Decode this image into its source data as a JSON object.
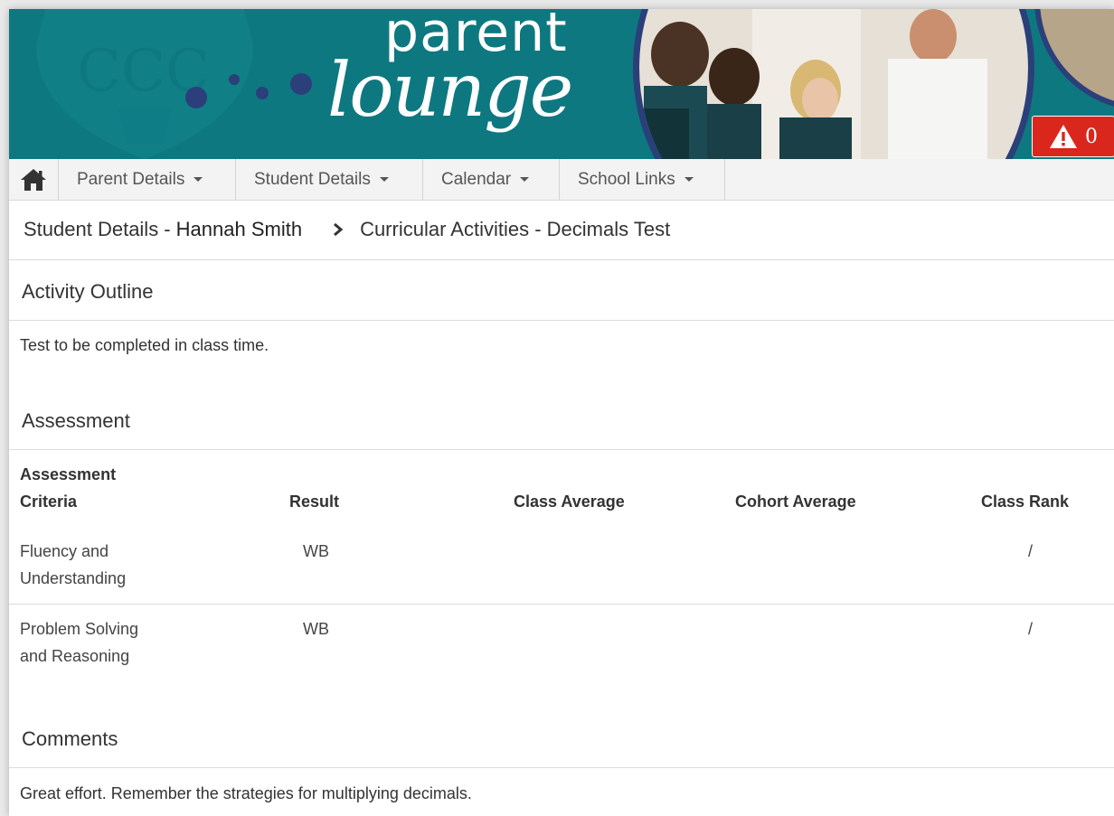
{
  "banner": {
    "logo_line1": "parent",
    "logo_line2": "lounge",
    "alert_count": "0",
    "colors": {
      "teal": "#0e7880",
      "alert_red": "#d9271e"
    }
  },
  "nav": {
    "items": [
      {
        "label": "Parent Details"
      },
      {
        "label": "Student Details"
      },
      {
        "label": "Calendar"
      },
      {
        "label": "School Links"
      }
    ]
  },
  "breadcrumb": {
    "student_prefix": "Student Details -",
    "student_name": "Hannah Smith",
    "current": "Curricular Activities - Decimals Test"
  },
  "activity_outline": {
    "title": "Activity Outline",
    "text": "Test to be completed in class time."
  },
  "assessment": {
    "title": "Assessment",
    "columns": {
      "criteria_line1": "Assessment",
      "criteria_line2": "Criteria",
      "result": "Result",
      "class_average": "Class Average",
      "cohort_average": "Cohort Average",
      "class_rank": "Class Rank"
    },
    "rows": [
      {
        "criteria_line1": "Fluency and",
        "criteria_line2": "Understanding",
        "result": "WB",
        "class_average": "",
        "cohort_average": "",
        "class_rank": "/"
      },
      {
        "criteria_line1": "Problem Solving",
        "criteria_line2": "and Reasoning",
        "result": "WB",
        "class_average": "",
        "cohort_average": "",
        "class_rank": "/"
      }
    ]
  },
  "comments": {
    "title": "Comments",
    "text": "Great effort. Remember the strategies for multiplying decimals."
  }
}
